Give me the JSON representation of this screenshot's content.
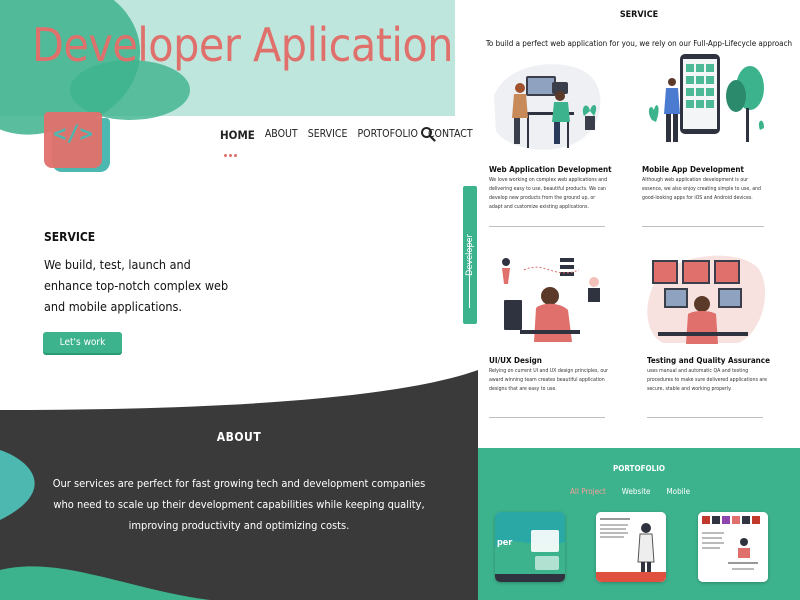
{
  "hero": {
    "title": "Developer Aplication"
  },
  "logo": {
    "glyph": "</>"
  },
  "nav": {
    "items": [
      "HOME",
      "ABOUT",
      "SERVICE",
      "PORTOFOLIO",
      "CONTACT"
    ]
  },
  "service_intro": {
    "heading": "SERVICE",
    "text": "We build, test, launch and enhance top-notch complex web and mobile applications.",
    "button": "Let's work"
  },
  "about": {
    "heading": "ABOUT",
    "text": "Our services are perfect for fast growing tech and development companies who need to scale up their development capabilities while keeping quality, improving productivity and optimizing costs."
  },
  "side_tab": {
    "label": "Developer"
  },
  "services": {
    "heading": "SERVICE",
    "subheading": "To build a perfect web application for you, we rely on our Full-App-Lifecycle approach",
    "cards": [
      {
        "title": "Web Application  Development",
        "text": "We love working on complex web applications and delivering easy to use, beautiful products. We can develop new products from the ground up, or adapt and customize existing applications."
      },
      {
        "title": "Mobile App Development",
        "text": "Although web application development is our essence, we also enjoy creating simple to use, and good-looking apps for iOS and Android devices."
      },
      {
        "title": "UI/UX Design",
        "text": "Relying on current UI and UX design principles, our award winning team creates beautiful application designs that are easy to use."
      },
      {
        "title": "Testing and Quality Assurance",
        "text": "uses manual and automatic QA and testing procedures to make sure delivered applications are secure, stable and working properly."
      }
    ]
  },
  "portfolio": {
    "heading": "PORTOFOLIO",
    "tabs": [
      "All Project",
      "Website",
      "Mobile"
    ],
    "selected_tab": "All Project",
    "thumb1_text": "per"
  },
  "colors": {
    "green": "#3db38d",
    "mint": "#bfe6dc",
    "coral": "#e0706b",
    "teal": "#4cb8b0",
    "dark": "#3a3a3a"
  }
}
